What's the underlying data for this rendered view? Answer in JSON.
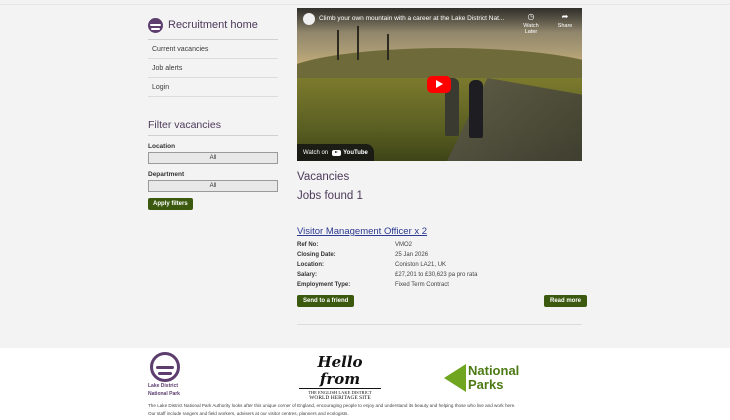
{
  "sidebar": {
    "title": "Recruitment home",
    "links": [
      "Current vacancies",
      "Job alerts",
      "Login"
    ]
  },
  "filters": {
    "title": "Filter vacancies",
    "location_label": "Location",
    "location_value": "All",
    "department_label": "Department",
    "department_value": "All",
    "apply_label": "Apply filters"
  },
  "video": {
    "title": "Climb your own mountain with a career at the Lake District Nat...",
    "watch_later": "Watch Later",
    "share": "Share",
    "watch_on": "Watch on",
    "youtube": "YouTube"
  },
  "main": {
    "heading": "Vacancies",
    "jobs_found": "Jobs found 1"
  },
  "job": {
    "title": "Visitor Management Officer x 2",
    "details": [
      {
        "label": "Ref No:",
        "value": "VMO2"
      },
      {
        "label": "Closing Date:",
        "value": "25 Jan 2026"
      },
      {
        "label": "Location:",
        "value": "Coniston LA21, UK"
      },
      {
        "label": "Salary:",
        "value": "£27,201 to £30,623 pa pro rata"
      },
      {
        "label": "Employment Type:",
        "value": "Fixed Term Contract"
      }
    ],
    "send_label": "Send to a friend",
    "read_label": "Read more"
  },
  "footer": {
    "ldnp_line1": "Lake District",
    "ldnp_line2": "National Park",
    "hello_main": "Hello from",
    "hello_sub1": "THE ENGLISH LAKE DISTRICT",
    "hello_sub2": "WORLD HERITAGE SITE",
    "np_line1": "National",
    "np_line2": "Parks",
    "text_line1": "The Lake District National Park Authority looks after this unique corner of England, encouraging people to enjoy and understand its beauty and helping those who live and work here.",
    "text_line2": "Our staff include rangers and field workers, advisers at our visitor centres, planners and ecologists."
  },
  "colors": {
    "brand_purple": "#5c3d6e",
    "button_green": "#3b5a10",
    "link_blue": "#2b3990",
    "np_green": "#6fa51f"
  }
}
